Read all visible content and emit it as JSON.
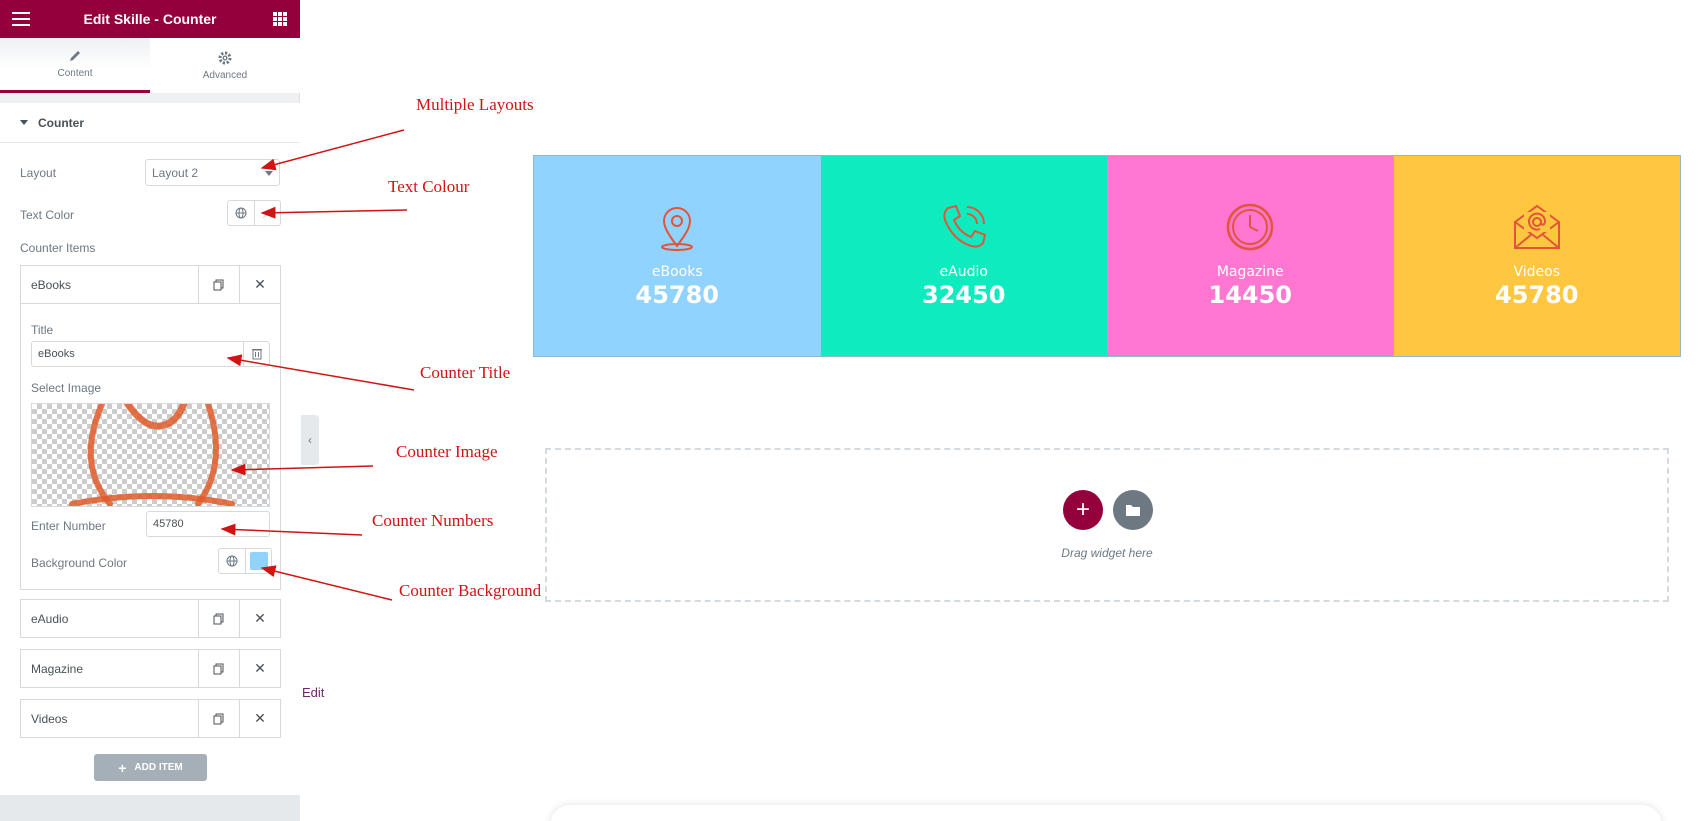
{
  "header": {
    "title": "Edit Skille - Counter"
  },
  "tabs": [
    {
      "label": "Content"
    },
    {
      "label": "Advanced"
    }
  ],
  "section": {
    "title": "Counter"
  },
  "fields": {
    "layout_label": "Layout",
    "layout_value": "Layout 2",
    "text_color_label": "Text Color",
    "counter_items_label": "Counter Items",
    "title_label": "Title",
    "title_value": "eBooks",
    "select_image_label": "Select Image",
    "number_label": "Enter Number",
    "number_value": "45780",
    "bg_color_label": "Background Color",
    "bg_color_value": "#8fd3fe"
  },
  "items": [
    {
      "name": "eBooks"
    },
    {
      "name": "eAudio"
    },
    {
      "name": "Magazine"
    },
    {
      "name": "Videos"
    }
  ],
  "add_item_label": "ADD ITEM",
  "edit_link": "Edit",
  "counters": [
    {
      "title": "eBooks",
      "number": "45780",
      "bg": "#8fd3fe",
      "icon": "location-pin-icon"
    },
    {
      "title": "eAudio",
      "number": "32450",
      "bg": "#0eecbf",
      "icon": "phone-icon"
    },
    {
      "title": "Magazine",
      "number": "14450",
      "bg": "#ff77d1",
      "icon": "clock-icon"
    },
    {
      "title": "Videos",
      "number": "45780",
      "bg": "#ffc640",
      "icon": "envelope-icon"
    }
  ],
  "dropzone": {
    "text": "Drag widget here"
  },
  "annotations": {
    "layouts": "Multiple Layouts",
    "text_colour": "Text Colour",
    "counter_title": "Counter Title",
    "counter_image": "Counter Image",
    "counter_numbers": "Counter Numbers",
    "counter_background": "Counter Background"
  },
  "colors": {
    "accent": "#93003c",
    "annotation": "#d01414",
    "icon_stroke": "#e2553b"
  }
}
